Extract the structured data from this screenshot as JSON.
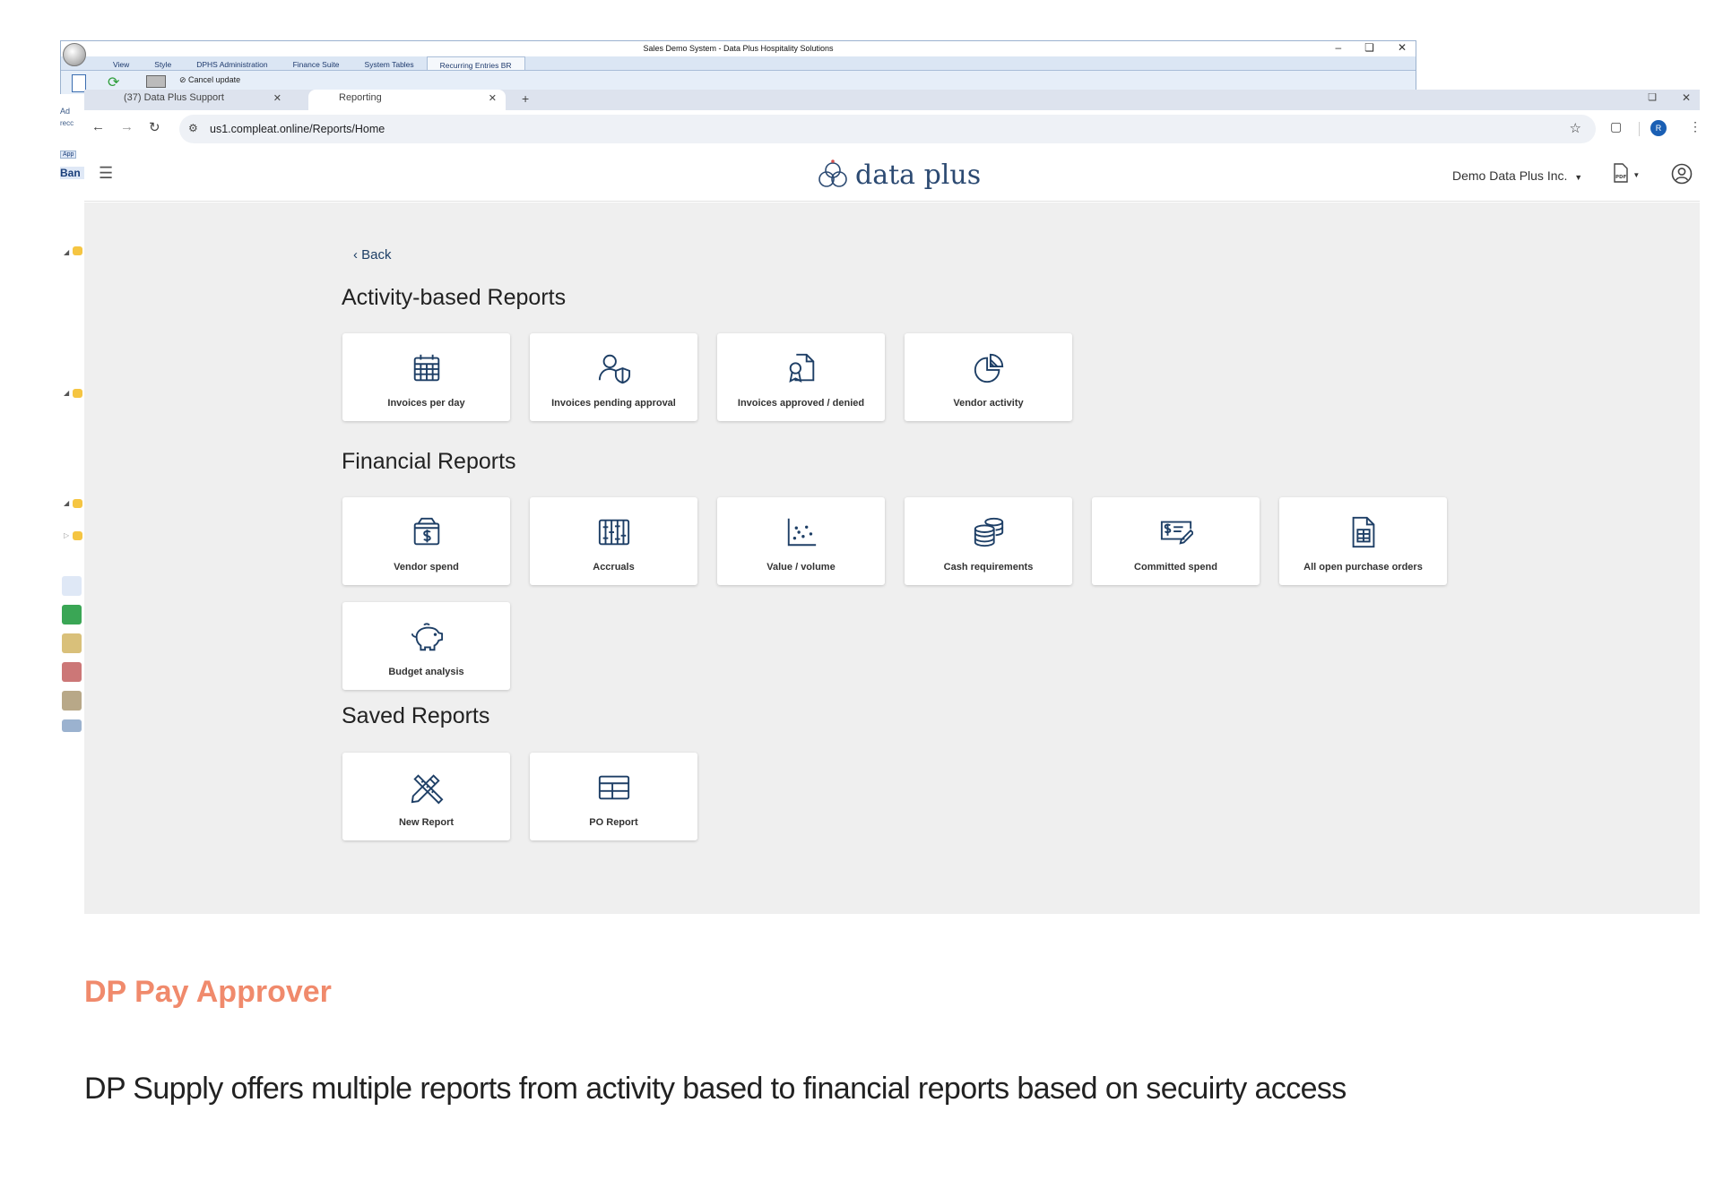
{
  "windows_app": {
    "title": "Sales Demo System - Data Plus Hospitality Solutions",
    "ribbon_tabs": [
      "View",
      "Style",
      "DPHS Administration",
      "Finance Suite",
      "System Tables",
      "Recurring Entries BR"
    ],
    "cancel_update_label": "Cancel update",
    "left_fragments": [
      "Ad",
      "recc",
      "App",
      "Ban"
    ]
  },
  "browser": {
    "tabs": [
      {
        "label": "(37) Data Plus Support"
      },
      {
        "label": "Reporting"
      }
    ],
    "new_tab": "+",
    "url": "us1.compleat.online/Reports/Home",
    "profile_initial": "R"
  },
  "app_header": {
    "logo_text": "data plus",
    "company": "Demo Data Plus Inc.",
    "pdf_label": "PDF"
  },
  "content": {
    "back_label": "Back",
    "sections": [
      {
        "title": "Activity-based Reports",
        "cards": [
          {
            "label": "Invoices per day",
            "icon": "calendar-icon"
          },
          {
            "label": "Invoices pending approval",
            "icon": "user-shield-icon"
          },
          {
            "label": "Invoices approved / denied",
            "icon": "certificate-document-icon"
          },
          {
            "label": "Vendor activity",
            "icon": "pie-chart-icon"
          }
        ]
      },
      {
        "title": "Financial Reports",
        "cards": [
          {
            "label": "Vendor spend",
            "icon": "dollar-box-icon"
          },
          {
            "label": "Accruals",
            "icon": "abacus-icon"
          },
          {
            "label": "Value / volume",
            "icon": "scatter-chart-icon"
          },
          {
            "label": "Cash requirements",
            "icon": "coin-stack-icon"
          },
          {
            "label": "Committed spend",
            "icon": "check-pen-icon"
          },
          {
            "label": "All open purchase orders",
            "icon": "document-table-icon"
          },
          {
            "label": "Budget analysis",
            "icon": "piggy-bank-icon"
          }
        ]
      },
      {
        "title": "Saved Reports",
        "cards": [
          {
            "label": "New Report",
            "icon": "pencil-ruler-icon"
          },
          {
            "label": "PO Report",
            "icon": "table-icon"
          }
        ]
      }
    ]
  },
  "caption": {
    "title": "DP Pay Approver",
    "description": "DP Supply offers multiple reports from activity based to financial reports based on secuirty access"
  },
  "colors": {
    "accent_orange": "#f08a6c",
    "navy": "#1e3f66",
    "content_bg": "#efefef"
  }
}
